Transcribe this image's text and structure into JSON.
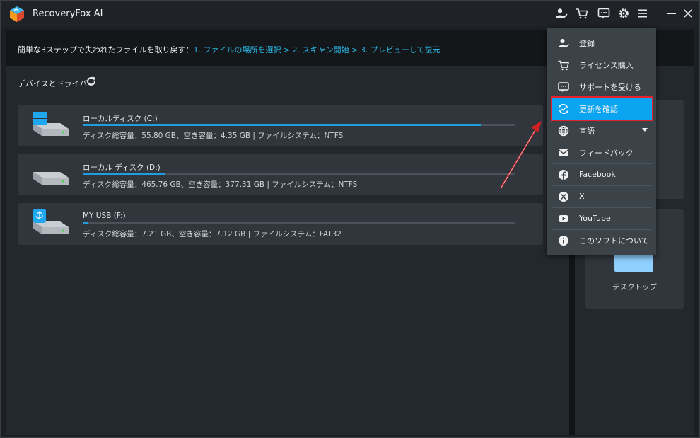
{
  "app": {
    "title": "RecoveryFox AI"
  },
  "banner": {
    "prefix": "簡単な3ステップで失われたファイルを取り戻す：",
    "steps": "1. ファイルの場所を選択 > 2. スキャン開始 > 3. プレビューして復元"
  },
  "devices": {
    "title": "デバイスとドライバー",
    "drives": [
      {
        "name": "ローカルディスク (C:)",
        "info": "ディスク総容量：55.80 GB、空き容量：4.35 GB | ファイルシステム：NTFS",
        "used_fraction": 0.92,
        "icon": "windows-drive-icon"
      },
      {
        "name": "ローカル ディスク (D:)",
        "info": "ディスク総容量：465.76 GB、空き容量：377.31 GB | ファイルシステム：NTFS",
        "used_fraction": 0.19,
        "icon": "hard-drive-icon"
      },
      {
        "name": "MY USB (F:)",
        "info": "ディスク総容量：7.21 GB、空き容量：7.12 GB | ファイルシステム：FAT32",
        "used_fraction": 0.013,
        "icon": "usb-drive-icon"
      }
    ]
  },
  "right_panel": {
    "desktop_label": "デスクトップ"
  },
  "menu": {
    "items": [
      {
        "label": "登録",
        "icon": "user-check-icon"
      },
      {
        "label": "ライセンス購入",
        "icon": "cart-icon"
      },
      {
        "label": "サポートを受ける",
        "icon": "chat-icon"
      },
      {
        "label": "更新を確認",
        "icon": "update-icon",
        "highlighted": true
      },
      {
        "label": "言語",
        "icon": "globe-icon",
        "has_submenu": true
      },
      {
        "label": "フィードバック",
        "icon": "mail-icon"
      },
      {
        "label": "Facebook",
        "icon": "facebook-icon"
      },
      {
        "label": "X",
        "icon": "x-icon"
      },
      {
        "label": "YouTube",
        "icon": "youtube-icon"
      },
      {
        "label": "このソフトについて",
        "icon": "info-icon"
      }
    ]
  },
  "colors": {
    "accent": "#0aa4f0",
    "highlight_border": "#e8202a",
    "steps_text": "#2ab7e6",
    "annotation_arrow": "#d42025"
  }
}
